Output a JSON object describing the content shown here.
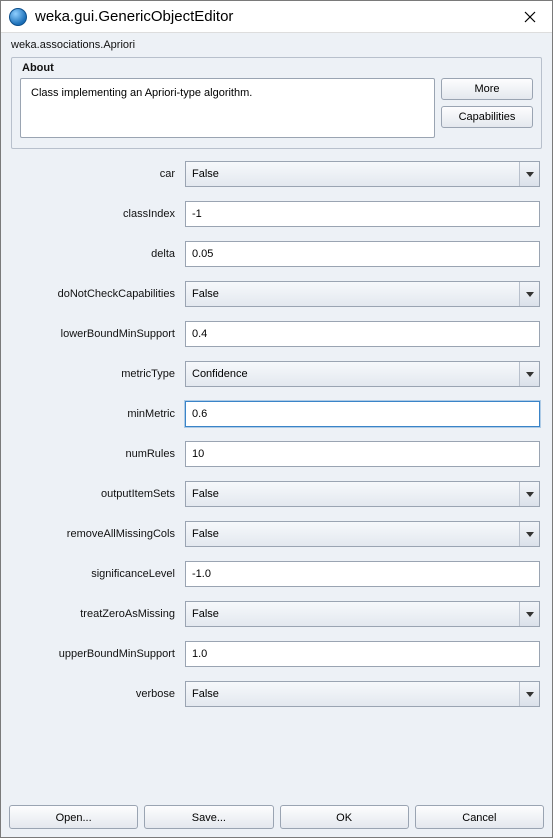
{
  "window": {
    "title": "weka.gui.GenericObjectEditor"
  },
  "classpath": "weka.associations.Apriori",
  "about": {
    "legend": "About",
    "description": "Class implementing an Apriori-type algorithm.",
    "more_label": "More",
    "capabilities_label": "Capabilities"
  },
  "params": [
    {
      "name": "car",
      "type": "select",
      "value": "False"
    },
    {
      "name": "classIndex",
      "type": "text",
      "value": "-1"
    },
    {
      "name": "delta",
      "type": "text",
      "value": "0.05"
    },
    {
      "name": "doNotCheckCapabilities",
      "type": "select",
      "value": "False"
    },
    {
      "name": "lowerBoundMinSupport",
      "type": "text",
      "value": "0.4"
    },
    {
      "name": "metricType",
      "type": "select",
      "value": "Confidence"
    },
    {
      "name": "minMetric",
      "type": "text",
      "value": "0.6",
      "focused": true
    },
    {
      "name": "numRules",
      "type": "text",
      "value": "10"
    },
    {
      "name": "outputItemSets",
      "type": "select",
      "value": "False"
    },
    {
      "name": "removeAllMissingCols",
      "type": "select",
      "value": "False"
    },
    {
      "name": "significanceLevel",
      "type": "text",
      "value": "-1.0"
    },
    {
      "name": "treatZeroAsMissing",
      "type": "select",
      "value": "False"
    },
    {
      "name": "upperBoundMinSupport",
      "type": "text",
      "value": "1.0"
    },
    {
      "name": "verbose",
      "type": "select",
      "value": "False"
    }
  ],
  "footer": {
    "open_label": "Open...",
    "save_label": "Save...",
    "ok_label": "OK",
    "cancel_label": "Cancel"
  }
}
